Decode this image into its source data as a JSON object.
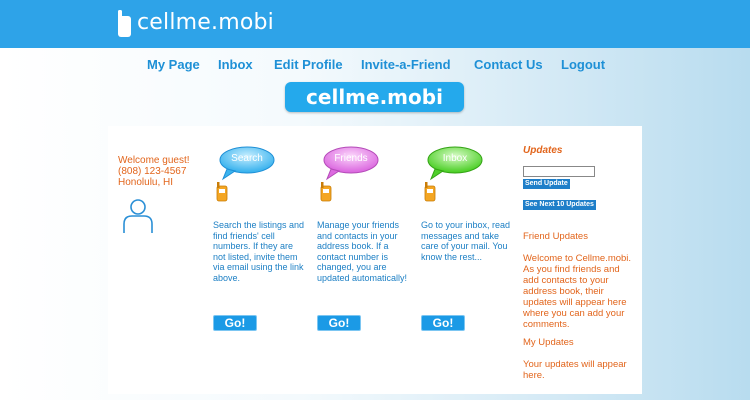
{
  "header": {
    "logo_text": "cellme.mobi",
    "logo_icon": "phone-logo-icon",
    "background": "#2ea3e8"
  },
  "nav": {
    "items": [
      {
        "label": "My Page"
      },
      {
        "label": "Inbox"
      },
      {
        "label": "Edit Profile"
      },
      {
        "label": "Invite-a-Friend"
      },
      {
        "label": "Contact Us"
      },
      {
        "label": "Logout"
      }
    ]
  },
  "brand_badge": "cellme.mobi",
  "welcome": {
    "greeting": "Welcome guest!",
    "phone": "(808) 123-4567",
    "location": "Honolulu, HI",
    "avatar_icon": "user-avatar-icon"
  },
  "features": [
    {
      "bubble": "Search",
      "bubble_color": "#5cc6f2",
      "description": "Search the listings and find friends' cell numbers. If they are not listed, invite them via email using the link above.",
      "button": "Go!"
    },
    {
      "bubble": "Friends",
      "bubble_color": "#e682e8",
      "description": "Manage your friends and contacts in your address book. If a contact number is changed, you are updated automatically!",
      "button": "Go!"
    },
    {
      "bubble": "Inbox",
      "bubble_color": "#5fdc3c",
      "description": "Go to your inbox, read messages and take care of your mail. You know the rest...",
      "button": "Go!"
    }
  ],
  "updates": {
    "title": "Updates",
    "input_value": "",
    "send_button": "Send Update",
    "next_button": "See Next 10 Updates",
    "friend_updates_heading": "Friend Updates",
    "friend_updates_text": "Welcome to Cellme.mobi. As you find friends and add contacts to your address book, their updates will appear here where you can add your comments.",
    "my_updates_heading": "My Updates",
    "my_updates_text": "Your updates will appear here."
  },
  "colors": {
    "accent_orange": "#e2651c",
    "link_blue": "#1e90d6",
    "button_blue": "#1b9ae6"
  }
}
